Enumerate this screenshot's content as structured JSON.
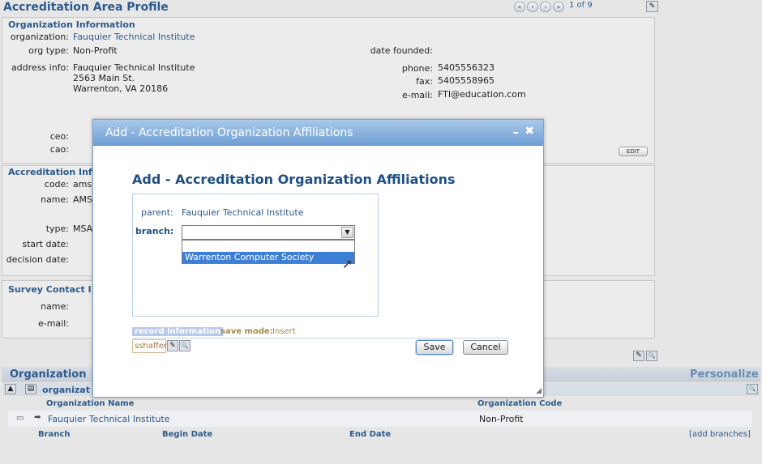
{
  "page": {
    "title": "Accreditation Area Profile",
    "pager_text": "1  of 9"
  },
  "org_info": {
    "title": "Organization Information",
    "organization_label": "organization:",
    "organization_value": "Fauquier Technical Institute",
    "org_type_label": "org type:",
    "org_type_value": "Non-Profit",
    "date_founded_label": "date founded:",
    "address_label": "address info:",
    "address_lines": [
      "Fauquier Technical Institute",
      "2563 Main St.",
      "Warrenton, VA 20186"
    ],
    "phone_label": "phone:",
    "phone_value": "5405556323",
    "fax_label": "fax:",
    "fax_value": "5405558965",
    "email_label": "e-mail:",
    "email_value": "FTI@education.com",
    "ceo_label": "ceo:",
    "cao_label": "cao:",
    "edit_label": "EDIT"
  },
  "accreditation_info": {
    "title": "Accreditation Inf",
    "code_label": "code:",
    "code_value": "ams",
    "name_label": "name:",
    "name_value": "AMS",
    "type_label": "type:",
    "type_value": "MSA",
    "start_date_label": "start date:",
    "decision_date_label": "decision date:"
  },
  "survey_contact": {
    "title": "Survey Contact I",
    "name_label": "name:",
    "email_label": "e-mail:"
  },
  "organization_grid": {
    "title": "Organization",
    "personalize": "Personalize",
    "sub_title": "organizat",
    "headers": {
      "name": "Organization Name",
      "code": "Organization Code"
    },
    "row": {
      "name": "Fauquier Technical Institute",
      "code": "Non-Profit"
    },
    "branch_headers": {
      "branch": "Branch",
      "begin": "Begin Date",
      "end": "End Date"
    },
    "add_branches": "[add branches]"
  },
  "modal": {
    "header_title": "Add - Accreditation Organization Affiliations",
    "heading": "Add - Accreditation Organization Affiliations",
    "parent_label": "parent:",
    "parent_value": "Fauquier Technical Institute",
    "branch_label": "branch:",
    "branch_selected": "",
    "dropdown_options": [
      "",
      "Warrenton Computer Society"
    ],
    "record_info_label": "record information",
    "save_mode_label": "save mode:",
    "save_mode_value": "Insert",
    "user_value": "sshaffer",
    "save_label": "Save",
    "cancel_label": "Cancel"
  },
  "icons": {
    "pencil": "✎",
    "search": "🔍",
    "first": "«",
    "prev": "‹",
    "next": "›",
    "last": "»"
  }
}
